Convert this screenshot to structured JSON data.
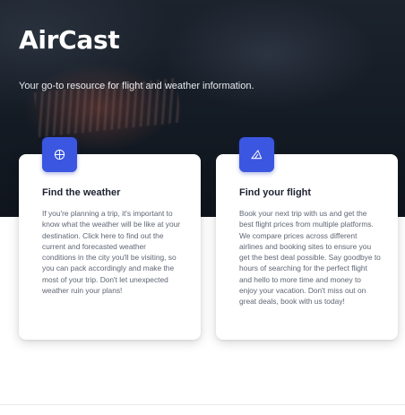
{
  "hero": {
    "title": "AirCast",
    "subtitle": "Your go-to resource for flight and weather information."
  },
  "cards": [
    {
      "icon": "globe-icon",
      "title": "Find the weather",
      "text": "If you're planning a trip, it's important to know what the weather will be like at your destination. Click here to find out the current and forecasted weather conditions in the city you'll be visiting, so you can pack accordingly and make the most of your trip. Don't let unexpected weather ruin your plans!"
    },
    {
      "icon": "paper-plane-icon",
      "title": "Find your flight",
      "text": "Book your next trip with us and get the best flight prices from multiple platforms. We compare prices across different airlines and booking sites to ensure you get the best deal possible. Say goodbye to hours of searching for the perfect flight and hello to more time and money to enjoy your vacation. Don't miss out on great deals, book with us today!"
    }
  ],
  "colors": {
    "accent": "#3b56e0",
    "hero_background": "#151c25"
  }
}
